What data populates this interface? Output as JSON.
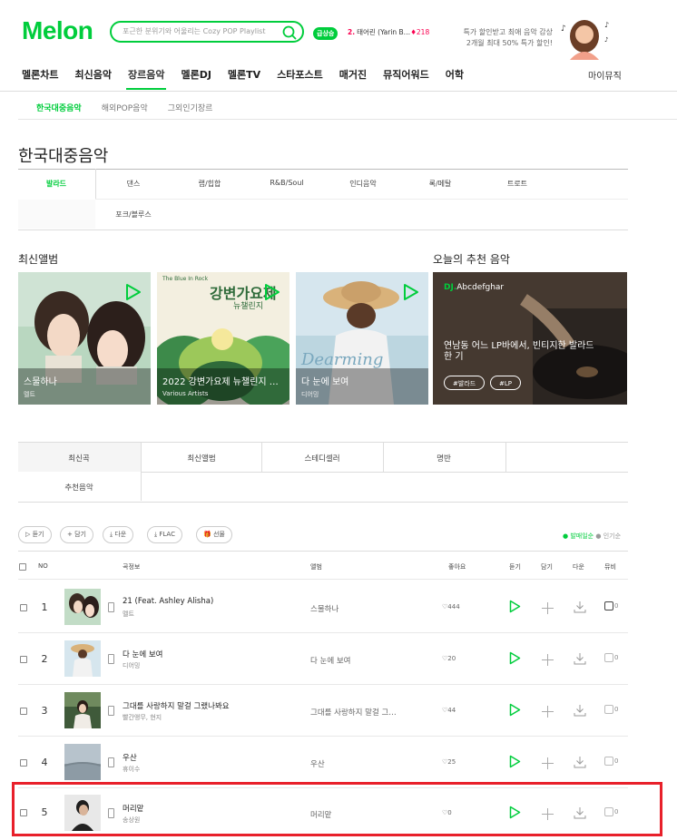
{
  "header": {
    "logo": "Melon",
    "search_placeholder": "포근한 분위기와 어울리는 Cozy POP Playlist",
    "rise_badge": "급상승",
    "rank_num": "2.",
    "rank_text": "태어린 (Yarin B…",
    "rank_change": "♦218",
    "promo_line1": "특가 할인받고 최애 음악 감상",
    "promo_line2": "2개월 최대 50% 특가 할인!"
  },
  "nav": {
    "items": [
      "멜론차트",
      "최신음악",
      "장르음악",
      "멜론DJ",
      "멜론TV",
      "스타포스트",
      "매거진",
      "뮤직어워드",
      "어학"
    ],
    "active_index": 2,
    "mymusic": "마이뮤직"
  },
  "subnav": {
    "items": [
      "한국대중음악",
      "해외POP음악",
      "그외인기장르"
    ],
    "active_index": 0
  },
  "page_title": "한국대중음악",
  "genres": {
    "row1": [
      "발라드",
      "댄스",
      "랩/힙합",
      "R&B/Soul",
      "인디음악",
      "록/메탈",
      "트로트"
    ],
    "row2": [
      "포크/블루스"
    ],
    "active_index": 0
  },
  "sections": {
    "new_albums": "최신앨범",
    "today_rec": "오늘의 추천 음악"
  },
  "albums": [
    {
      "title": "스물하나",
      "artist": "멜트"
    },
    {
      "title": "2022 강변가요제 뉴챌린지 …",
      "artist": "Various Artists",
      "cover_top": "The Blue In Rock",
      "cover_title": "강변가요제",
      "cover_sub": "뉴챌린지"
    },
    {
      "title": "다 눈에 보여",
      "artist": "디어밍",
      "cover_text": "Dearming"
    }
  ],
  "recommend": {
    "dj_prefix": "DJ.",
    "dj_name": "Abcdefghar",
    "title": "연남동 어느 LP바에서, 빈티지한 발라드 한 기",
    "tags": [
      "#발라드",
      "#LP"
    ]
  },
  "tabs": {
    "row1": [
      "최신곡",
      "최신앨범",
      "스테디셀러",
      "명반"
    ],
    "row2": [
      "추천음악"
    ],
    "active_index": 0
  },
  "actions": {
    "listen": "듣기",
    "add": "담기",
    "download": "다운",
    "flac": "FLAC",
    "gift": "선물"
  },
  "sort": {
    "by_release": "발매일순",
    "by_popularity": "인기순"
  },
  "table": {
    "headers": {
      "no": "NO",
      "song": "곡정보",
      "album": "앨범",
      "like": "좋아요",
      "listen": "듣기",
      "add": "담기",
      "download": "다운",
      "mv": "뮤비"
    },
    "rows": [
      {
        "no": "1",
        "title": "21 (Feat. Ashley Alisha)",
        "artist": "멜트",
        "album": "스물하나",
        "likes": "444",
        "mv": "0"
      },
      {
        "no": "2",
        "title": "다 눈에 보여",
        "artist": "디어밍",
        "album": "다 눈에 보여",
        "likes": "20",
        "mv": "0"
      },
      {
        "no": "3",
        "title": "그대를 사랑하지 말걸 그랬나봐요",
        "artist": "빨간앵무, 현지",
        "album": "그대를 사랑하지 말걸 그…",
        "likes": "44",
        "mv": "0"
      },
      {
        "no": "4",
        "title": "우산",
        "artist": "휴이수",
        "album": "우산",
        "likes": "25",
        "mv": "0"
      },
      {
        "no": "5",
        "title": "머리맡",
        "artist": "송상원",
        "album": "머리맡",
        "likes": "0",
        "mv": "0"
      }
    ]
  },
  "colors": {
    "brand": "#00cd3c",
    "highlight": "#e8202a",
    "rank": "#fa0050"
  }
}
